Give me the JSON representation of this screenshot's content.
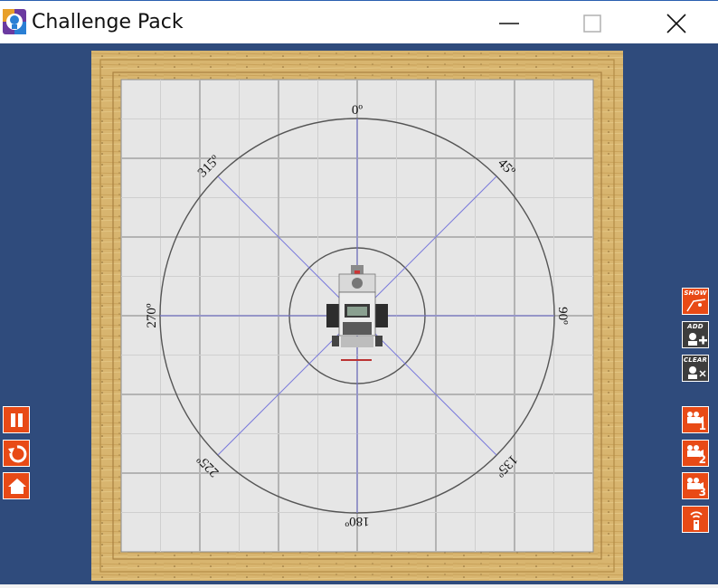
{
  "window": {
    "title": "Challenge Pack",
    "app_icon": "robot-app-icon",
    "controls": [
      "minimize-icon",
      "maximize-icon",
      "close-icon"
    ]
  },
  "arena": {
    "angle_labels": [
      "0º",
      "45º",
      "90º",
      "135º",
      "180º",
      "225º",
      "270º",
      "315º"
    ],
    "colors": {
      "frame": "#d8b56f",
      "mat": "#e6e6e6",
      "grid": "#b9b9b9",
      "circle": "#555555",
      "spokes": "#7a7adc"
    }
  },
  "left_controls": [
    {
      "name": "pause-button",
      "icon": "pause-icon"
    },
    {
      "name": "restart-button",
      "icon": "restart-icon"
    },
    {
      "name": "home-button",
      "icon": "home-icon"
    }
  ],
  "right_controls": {
    "show": {
      "caption": "SHOW",
      "icon": "trail-icon"
    },
    "add": {
      "caption": "ADD",
      "icon": "add-robot-icon"
    },
    "clear": {
      "caption": "CLEAR",
      "icon": "clear-robot-icon"
    },
    "cameras": [
      {
        "label": "1",
        "icon": "camera-icon"
      },
      {
        "label": "2",
        "icon": "camera-icon"
      },
      {
        "label": "3",
        "icon": "camera-icon"
      }
    ],
    "remote": {
      "icon": "remote-control-icon"
    }
  },
  "accent_color": "#e84a16",
  "background_color": "#2f4b7c"
}
